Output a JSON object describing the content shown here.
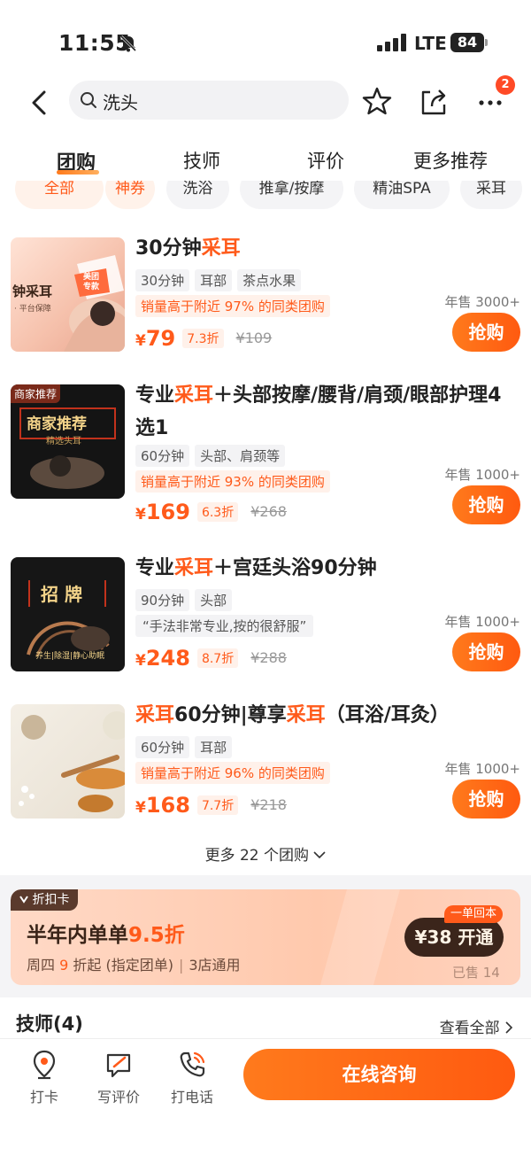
{
  "status_bar": {
    "time": "11:55",
    "network": "LTE",
    "battery": "84"
  },
  "header": {
    "search_text": "洗头",
    "more_badge": "2"
  },
  "tabs": [
    {
      "label": "团购",
      "active": true
    },
    {
      "label": "技师"
    },
    {
      "label": "评价"
    },
    {
      "label": "更多推荐"
    }
  ],
  "filters": [
    {
      "label": "全部"
    },
    {
      "label": "神券"
    },
    {
      "label": "洗浴"
    },
    {
      "label": "推拿/按摩"
    },
    {
      "label": "精油SPA"
    },
    {
      "label": "采耳"
    }
  ],
  "deals": [
    {
      "title_pre": "30分钟",
      "title_hl": "采耳",
      "title_post": "",
      "tags": [
        "30分钟",
        "耳部",
        "茶点水果"
      ],
      "note": "销量高于附近 97% 的同类团购",
      "note_type": "sales",
      "price": "79",
      "discount": "7.3折",
      "original": "¥109",
      "annual_sales": "年售 3000+",
      "buy_label": "抢购",
      "thumb_text": "钟采耳",
      "thumb_sub": "· 平台保障",
      "thumb_badge": "美团 专款"
    },
    {
      "title_pre": "专业",
      "title_hl": "采耳",
      "title_post": "＋头部按摩/腰背/肩颈/眼部护理4选1",
      "tags": [
        "60分钟",
        "头部、肩颈等"
      ],
      "note": "销量高于附近 93% 的同类团购",
      "note_type": "sales",
      "price": "169",
      "discount": "6.3折",
      "original": "¥268",
      "annual_sales": "年售 1000+",
      "buy_label": "抢购",
      "thumb_text": "商家推荐",
      "thumb_sub": "精选头耳",
      "thumb_badge": "商家推荐"
    },
    {
      "title_pre": "专业",
      "title_hl": "采耳",
      "title_post": "＋宫廷头浴90分钟",
      "tags": [
        "90分钟",
        "头部"
      ],
      "note": "“手法非常专业,按的很舒服”",
      "note_type": "review",
      "price": "248",
      "discount": "8.7折",
      "original": "¥288",
      "annual_sales": "年售 1000+",
      "buy_label": "抢购",
      "thumb_text": "招 牌",
      "thumb_sub": "养生|除湿|静心助眠",
      "thumb_badge": ""
    },
    {
      "title_pre": "",
      "title_hl": "采耳",
      "title_mid": "60分钟|尊享",
      "title_hl2": "采耳",
      "title_post": "（耳浴/耳灸）",
      "tags": [
        "60分钟",
        "耳部"
      ],
      "note": "销量高于附近 96% 的同类团购",
      "note_type": "sales",
      "price": "168",
      "discount": "7.7折",
      "original": "¥218",
      "annual_sales": "年售 1000+",
      "buy_label": "抢购"
    }
  ],
  "more_deals": "更多 22 个团购",
  "discount_card": {
    "label": "折扣卡",
    "title_pre": "半年内单单",
    "title_hl": "9.5折",
    "sub_pre": "周四 ",
    "sub_hl": "9",
    "sub_post": " 折起 (指定团单)",
    "sub_right": "3店通用",
    "tag": "一单回本",
    "button": "¥38 开通",
    "sold": "已售 14"
  },
  "technicians": {
    "title": "技师(4)",
    "view_all": "查看全部"
  },
  "bottom_bar": {
    "checkin": "打卡",
    "review": "写评价",
    "call": "打电话",
    "consult": "在线咨询"
  },
  "colors": {
    "accent": "#ff5a1a",
    "card_bg": "#ffd2bd",
    "card_btn": "#3b251b"
  }
}
